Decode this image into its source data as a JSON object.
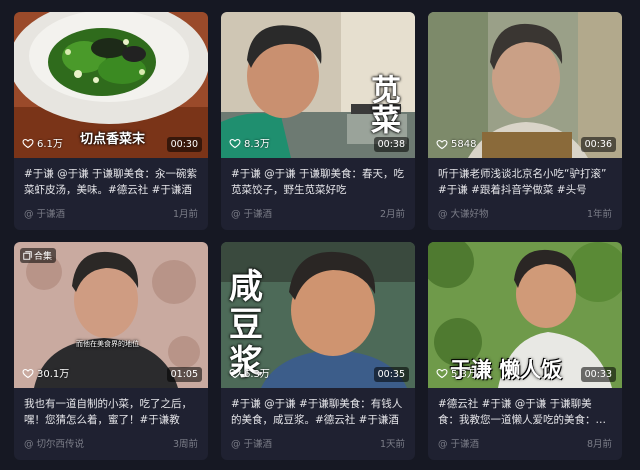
{
  "videos": [
    {
      "likes": "6.1万",
      "duration": "00:30",
      "overlay": "切点香菜末",
      "description": "#于谦 @于谦 于谦聊美食：汆一碗紫菜虾皮汤，美味。#德云社 #于谦酒",
      "author": "@ 于谦酒",
      "time": "1月前",
      "badge": ""
    },
    {
      "likes": "8.3万",
      "duration": "00:38",
      "overlay": "苋菜",
      "description": "#于谦 @于谦 于谦聊美食：春天，吃苋菜饺子，野生苋菜好吃",
      "author": "@ 于谦酒",
      "time": "2月前",
      "badge": ""
    },
    {
      "likes": "5848",
      "duration": "00:36",
      "overlay": "",
      "description": "听于谦老师浅谈北京名小吃“驴打滚” #于谦 #跟着抖音学做菜 #头号",
      "author": "@ 大谦好物",
      "time": "1年前",
      "badge": ""
    },
    {
      "likes": "30.1万",
      "duration": "01:05",
      "overlay": "而他在美食界的地位",
      "description": "我也有一道自制的小菜，吃了之后，嘿！您猜怎么着，蜜了！#于谦教",
      "author": "@ 切尔西传说",
      "time": "3周前",
      "badge": "合集"
    },
    {
      "likes": "6.3万",
      "duration": "00:35",
      "overlay": "咸豆浆",
      "description": "#于谦 @于谦 #于谦聊美食：有钱人的美食，咸豆浆。#德云社 #于谦酒",
      "author": "@ 于谦酒",
      "time": "1天前",
      "badge": ""
    },
    {
      "likes": "5.3万",
      "duration": "00:33",
      "overlay": "于谦 懒人饭",
      "description": "#德云社 #于谦 @于谦 于谦聊美食：我教您一道懒人爱吃的美食：懒人",
      "author": "@ 于谦酒",
      "time": "8月前",
      "badge": ""
    }
  ],
  "colors": {
    "background": "#161823",
    "card": "#1f2131",
    "muted_text": "#7b7d88"
  }
}
